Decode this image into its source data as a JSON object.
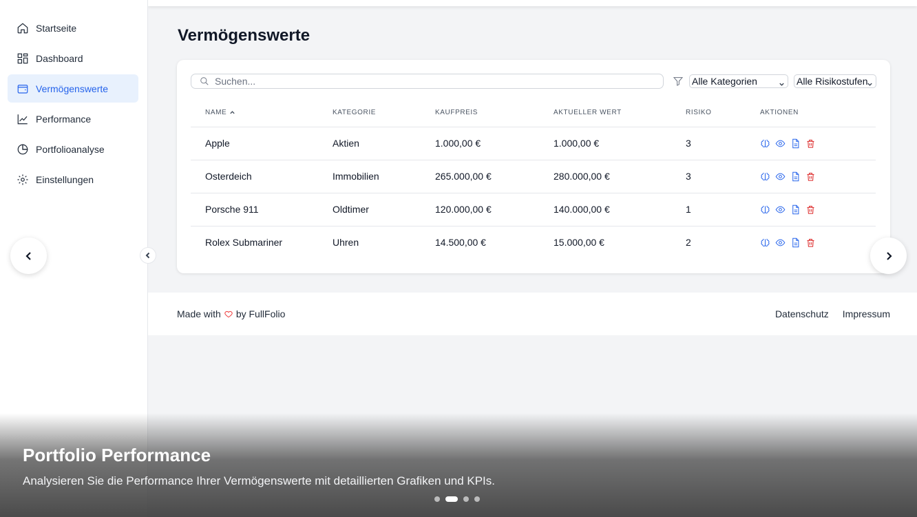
{
  "sidebar": {
    "items": [
      {
        "label": "Startseite",
        "icon": "home-icon"
      },
      {
        "label": "Dashboard",
        "icon": "dashboard-icon"
      },
      {
        "label": "Vermögenswerte",
        "icon": "wallet-icon",
        "active": true
      },
      {
        "label": "Performance",
        "icon": "line-chart-icon"
      },
      {
        "label": "Portfolioanalyse",
        "icon": "pie-chart-icon"
      },
      {
        "label": "Einstellungen",
        "icon": "gear-icon"
      }
    ]
  },
  "page": {
    "title": "Vermögenswerte"
  },
  "search": {
    "placeholder": "Suchen..."
  },
  "filters": {
    "category": {
      "selected": "Alle Kategorien"
    },
    "risk": {
      "selected": "Alle Risikostufen"
    }
  },
  "table": {
    "headers": [
      "NAME",
      "KATEGORIE",
      "KAUFPREIS",
      "AKTUELLER WERT",
      "RISIKO",
      "AKTIONEN"
    ],
    "sort": {
      "column": "NAME",
      "direction": "ascending"
    },
    "rows": [
      {
        "name": "Apple",
        "category": "Aktien",
        "purchase": "1.000,00 €",
        "current": "1.000,00 €",
        "risk": "3"
      },
      {
        "name": "Osterdeich",
        "category": "Immobilien",
        "purchase": "265.000,00 €",
        "current": "280.000,00 €",
        "risk": "3"
      },
      {
        "name": "Porsche 911",
        "category": "Oldtimer",
        "purchase": "120.000,00 €",
        "current": "140.000,00 €",
        "risk": "1"
      },
      {
        "name": "Rolex Submariner",
        "category": "Uhren",
        "purchase": "14.500,00 €",
        "current": "15.000,00 €",
        "risk": "2"
      }
    ],
    "action_icons": [
      "brain-icon",
      "eye-icon",
      "document-icon",
      "trash-icon"
    ]
  },
  "footer": {
    "made_prefix": "Made with",
    "made_suffix": "by FullFolio",
    "links": [
      "Datenschutz",
      "Impressum"
    ]
  },
  "carousel": {
    "title": "Portfolio Performance",
    "text": "Analysieren Sie die Performance Ihrer Vermögenswerte mit detaillierten Grafiken und KPIs.",
    "slide_count": 4,
    "active_slide": 2
  },
  "colors": {
    "accent": "#2563eb",
    "active_bg": "#e8f1fd",
    "danger": "#dc2626",
    "heart": "#ef4444"
  }
}
